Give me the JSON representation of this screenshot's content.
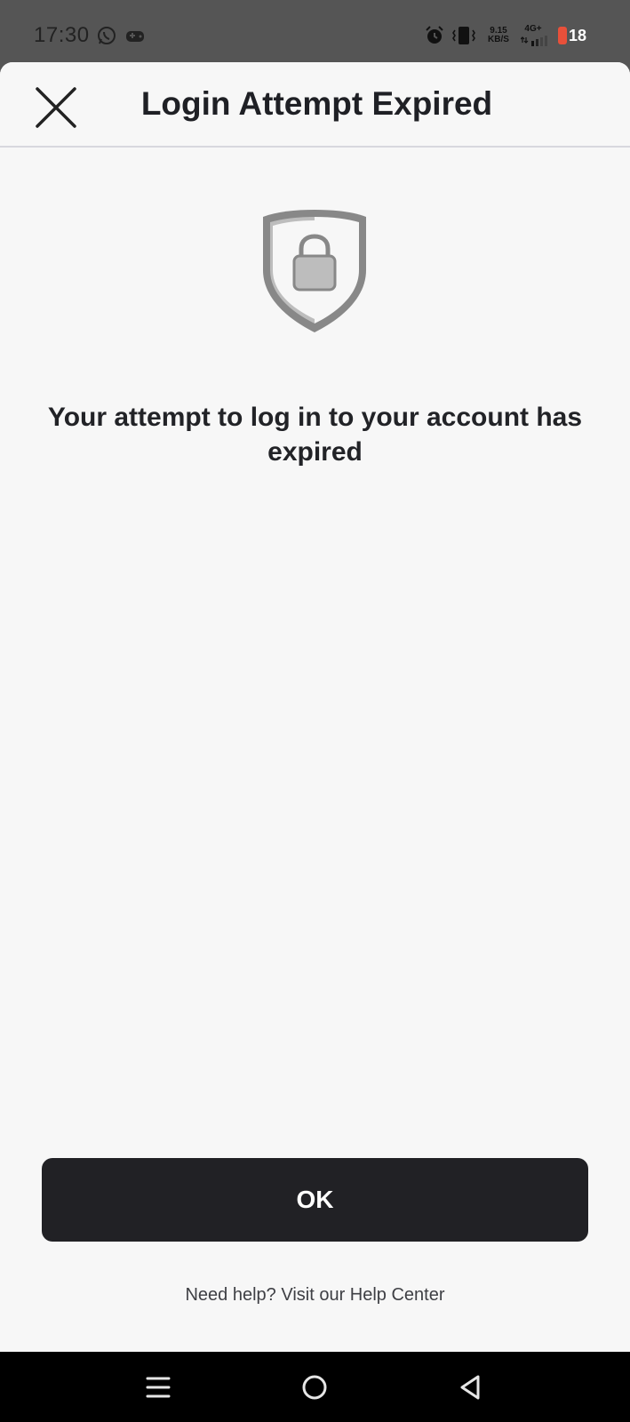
{
  "status_bar": {
    "time": "17:30",
    "net_speed_value": "9.15",
    "net_speed_unit": "KB/S",
    "network_type": "4G+",
    "battery_level": "18",
    "battery_color": "#e8503a"
  },
  "header": {
    "title": "Login Attempt Expired",
    "close_icon": "close-icon"
  },
  "main": {
    "icon": "shield-lock-icon",
    "message": "Your attempt to log in to your account has expired"
  },
  "actions": {
    "ok_label": "OK"
  },
  "footer": {
    "help_text": "Need help? Visit our Help Center"
  },
  "nav_bar": {
    "recents_icon": "menu-icon",
    "home_icon": "home-circle-icon",
    "back_icon": "back-triangle-icon"
  },
  "colors": {
    "background": "#f7f7f7",
    "button": "#212125",
    "text": "#1f2025"
  }
}
